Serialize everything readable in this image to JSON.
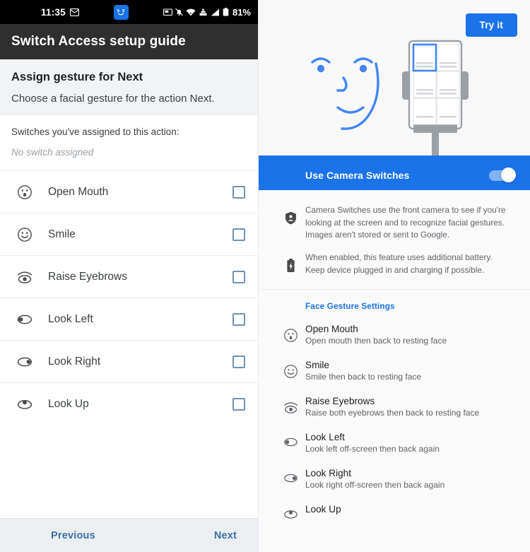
{
  "left": {
    "statusbar": {
      "time": "11:35",
      "battery_percent": "81%",
      "icons": [
        "envelope-icon",
        "camera-switches-face-icon",
        "screenshot-icon",
        "notifications-muted-icon",
        "wifi-icon",
        "vpn-icon",
        "signal-icon",
        "battery-icon"
      ]
    },
    "appbar": {
      "title": "Switch Access setup guide"
    },
    "assign": {
      "title": "Assign gesture for Next",
      "subtitle": "Choose a facial gesture for the action Next."
    },
    "assigned": {
      "label": "Switches you've assigned to this action:",
      "value": "No switch assigned"
    },
    "gestures": [
      {
        "label": "Open Mouth",
        "icon": "open-mouth-face-icon",
        "checked": false
      },
      {
        "label": "Smile",
        "icon": "smile-face-icon",
        "checked": false
      },
      {
        "label": "Raise Eyebrows",
        "icon": "raise-eyebrows-icon",
        "checked": false
      },
      {
        "label": "Look Left",
        "icon": "look-left-eye-icon",
        "checked": false
      },
      {
        "label": "Look Right",
        "icon": "look-right-eye-icon",
        "checked": false
      },
      {
        "label": "Look Up",
        "icon": "look-up-eye-icon",
        "checked": false
      }
    ],
    "bottom": {
      "previous": "Previous",
      "next": "Next"
    }
  },
  "right": {
    "hero": {
      "try_it": "Try it"
    },
    "toggle": {
      "label": "Use Camera Switches",
      "state": "on"
    },
    "info": [
      {
        "icon": "privacy-shield-icon",
        "text": "Camera Switches use the front camera to see if you're looking at the screen and to recognize facial gestures. Images aren't stored or sent to Google."
      },
      {
        "icon": "battery-charging-icon",
        "text": "When enabled, this feature uses additional battery. Keep device plugged in and charging if possible."
      }
    ],
    "section_title": "Face Gesture Settings",
    "gestures": [
      {
        "title": "Open Mouth",
        "sub": "Open mouth then back to resting face",
        "icon": "open-mouth-face-icon"
      },
      {
        "title": "Smile",
        "sub": "Smile then back to resting face",
        "icon": "smile-face-icon"
      },
      {
        "title": "Raise Eyebrows",
        "sub": "Raise both eyebrows then back to resting face",
        "icon": "raise-eyebrows-icon"
      },
      {
        "title": "Look Left",
        "sub": "Look left off-screen then back again",
        "icon": "look-left-eye-icon"
      },
      {
        "title": "Look Right",
        "sub": "Look right off-screen then back again",
        "icon": "look-right-eye-icon"
      },
      {
        "title": "Look Up",
        "sub": "",
        "icon": "look-up-eye-icon"
      }
    ]
  },
  "colors": {
    "accent_blue": "#1a73e8",
    "appbar_dark": "#2f2f2f",
    "page_gray": "#f1f3f4",
    "checkbox_border": "#6f93b5",
    "link_blue": "#3b6ea5"
  }
}
